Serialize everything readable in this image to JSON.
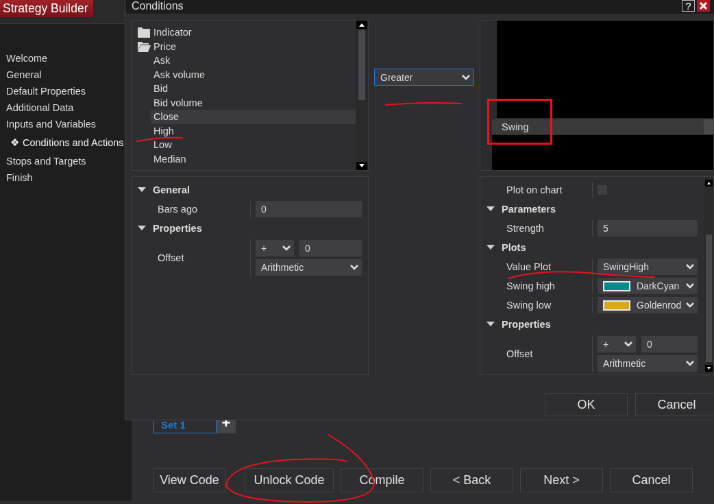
{
  "app": {
    "title": "Strategy Builder"
  },
  "sidebar": {
    "items": [
      {
        "label": "Welcome",
        "selected": false
      },
      {
        "label": "General",
        "selected": false
      },
      {
        "label": "Default Properties",
        "selected": false
      },
      {
        "label": "Additional Data",
        "selected": false
      },
      {
        "label": "Inputs and Variables",
        "selected": false
      },
      {
        "label": "Conditions and Actions",
        "selected": true,
        "marker": "❖"
      },
      {
        "label": "Stops and Targets",
        "selected": false
      },
      {
        "label": "Finish",
        "selected": false
      }
    ]
  },
  "dialog": {
    "title": "Conditions",
    "help_label": "?",
    "tree": {
      "items": [
        {
          "label": "Indicator",
          "kind": "folder",
          "expanded": false
        },
        {
          "label": "Price",
          "kind": "folder",
          "expanded": true,
          "children": [
            {
              "label": "Ask",
              "selected": false
            },
            {
              "label": "Ask volume",
              "selected": false
            },
            {
              "label": "Bid",
              "selected": false
            },
            {
              "label": "Bid volume",
              "selected": false
            },
            {
              "label": "Close",
              "selected": true
            },
            {
              "label": "High",
              "selected": false
            },
            {
              "label": "Low",
              "selected": false
            },
            {
              "label": "Median",
              "selected": false
            }
          ]
        }
      ]
    },
    "left_properties": {
      "items": [
        {
          "kind": "category",
          "label": "General",
          "expanded": true
        },
        {
          "kind": "text",
          "label": "Bars ago",
          "value": "0"
        },
        {
          "kind": "category",
          "label": "Properties",
          "expanded": true
        },
        {
          "kind": "offset",
          "label": "Offset",
          "sign": "+",
          "value": "0",
          "mode": "Arithmetic"
        }
      ]
    },
    "operator": {
      "value": "Greater"
    },
    "preview": {
      "items": [
        {
          "label": "Swing",
          "selected": true
        }
      ]
    },
    "right_properties": {
      "items": [
        {
          "kind": "checkbox",
          "label": "Plot on chart",
          "checked": false
        },
        {
          "kind": "category",
          "label": "Parameters",
          "expanded": true
        },
        {
          "kind": "text",
          "label": "Strength",
          "value": "5"
        },
        {
          "kind": "category",
          "label": "Plots",
          "expanded": true
        },
        {
          "kind": "select",
          "label": "Value Plot",
          "value": "SwingHigh"
        },
        {
          "kind": "color",
          "label": "Swing high",
          "value": "DarkCyan",
          "color": "#008b8b"
        },
        {
          "kind": "color",
          "label": "Swing low",
          "value": "Goldenrod",
          "color": "#daa520"
        },
        {
          "kind": "category",
          "label": "Properties",
          "expanded": true
        },
        {
          "kind": "offset",
          "label": "Offset",
          "sign": "+",
          "value": "0",
          "mode": "Arithmetic"
        }
      ]
    },
    "buttons": [
      "OK",
      "Cancel"
    ]
  },
  "sets": {
    "tabs": [
      {
        "label": "Set 1",
        "selected": true
      }
    ],
    "add_label": "+"
  },
  "footer": {
    "buttons": [
      "View Code",
      "Unlock Code",
      "Compile",
      "< Back",
      "Next >",
      "Cancel"
    ]
  },
  "annotations": [
    {
      "kind": "stroke"
    },
    {
      "kind": "stroke"
    },
    {
      "kind": "frame"
    },
    {
      "kind": "stroke"
    },
    {
      "kind": "loop"
    }
  ]
}
